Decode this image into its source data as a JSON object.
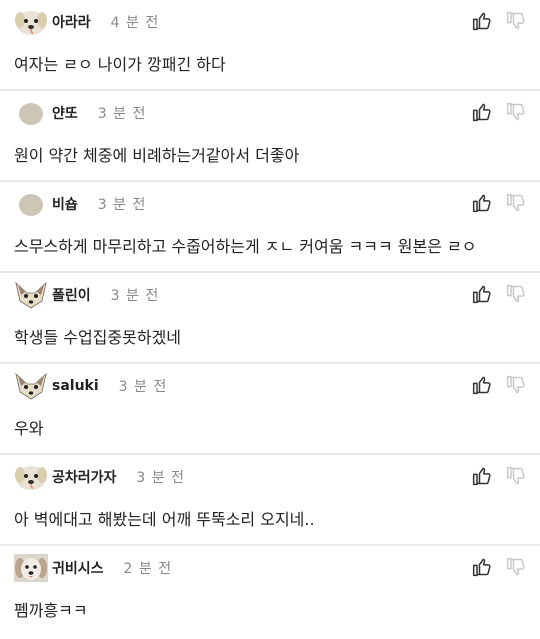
{
  "comments": [
    {
      "name": "아라라",
      "time": "4 분 전",
      "text": "여자는 ㄹㅇ 나이가 깡패긴 하다",
      "avatar": "dog-face-avatar"
    },
    {
      "name": "얀또",
      "time": "3 분 전",
      "text": "원이 약간 체중에 비례하는거같아서 더좋아",
      "avatar": "blob-avatar"
    },
    {
      "name": "비숍",
      "time": "3 분 전",
      "text": "스무스하게 마무리하고 수줍어하는게 ㅈㄴ 커여움 ㅋㅋㅋ 원본은 ㄹㅇ",
      "avatar": "blob-avatar"
    },
    {
      "name": "폴린이",
      "time": "3 분 전",
      "text": "학생들 수업집중못하겠네",
      "avatar": "chihuahua-avatar"
    },
    {
      "name": "saluki",
      "time": "3 분 전",
      "text": "우와",
      "avatar": "chihuahua-avatar"
    },
    {
      "name": "공차러가자",
      "time": "3 분 전",
      "text": "아 벽에대고 해봤는데 어깨 뚜뚝소리 오지네..",
      "avatar": "dog-face-avatar"
    },
    {
      "name": "귀비시스",
      "time": "2 분 전",
      "text": "펨까흥ㅋㅋ",
      "avatar": "dog-photo-avatar"
    }
  ],
  "icons": {
    "like": "thumbs-up-icon",
    "dislike": "thumbs-down-icon"
  },
  "colors": {
    "text": "#222222",
    "muted": "#888888",
    "divider": "#e9e9e9",
    "dislike": "#c8c8c8"
  }
}
